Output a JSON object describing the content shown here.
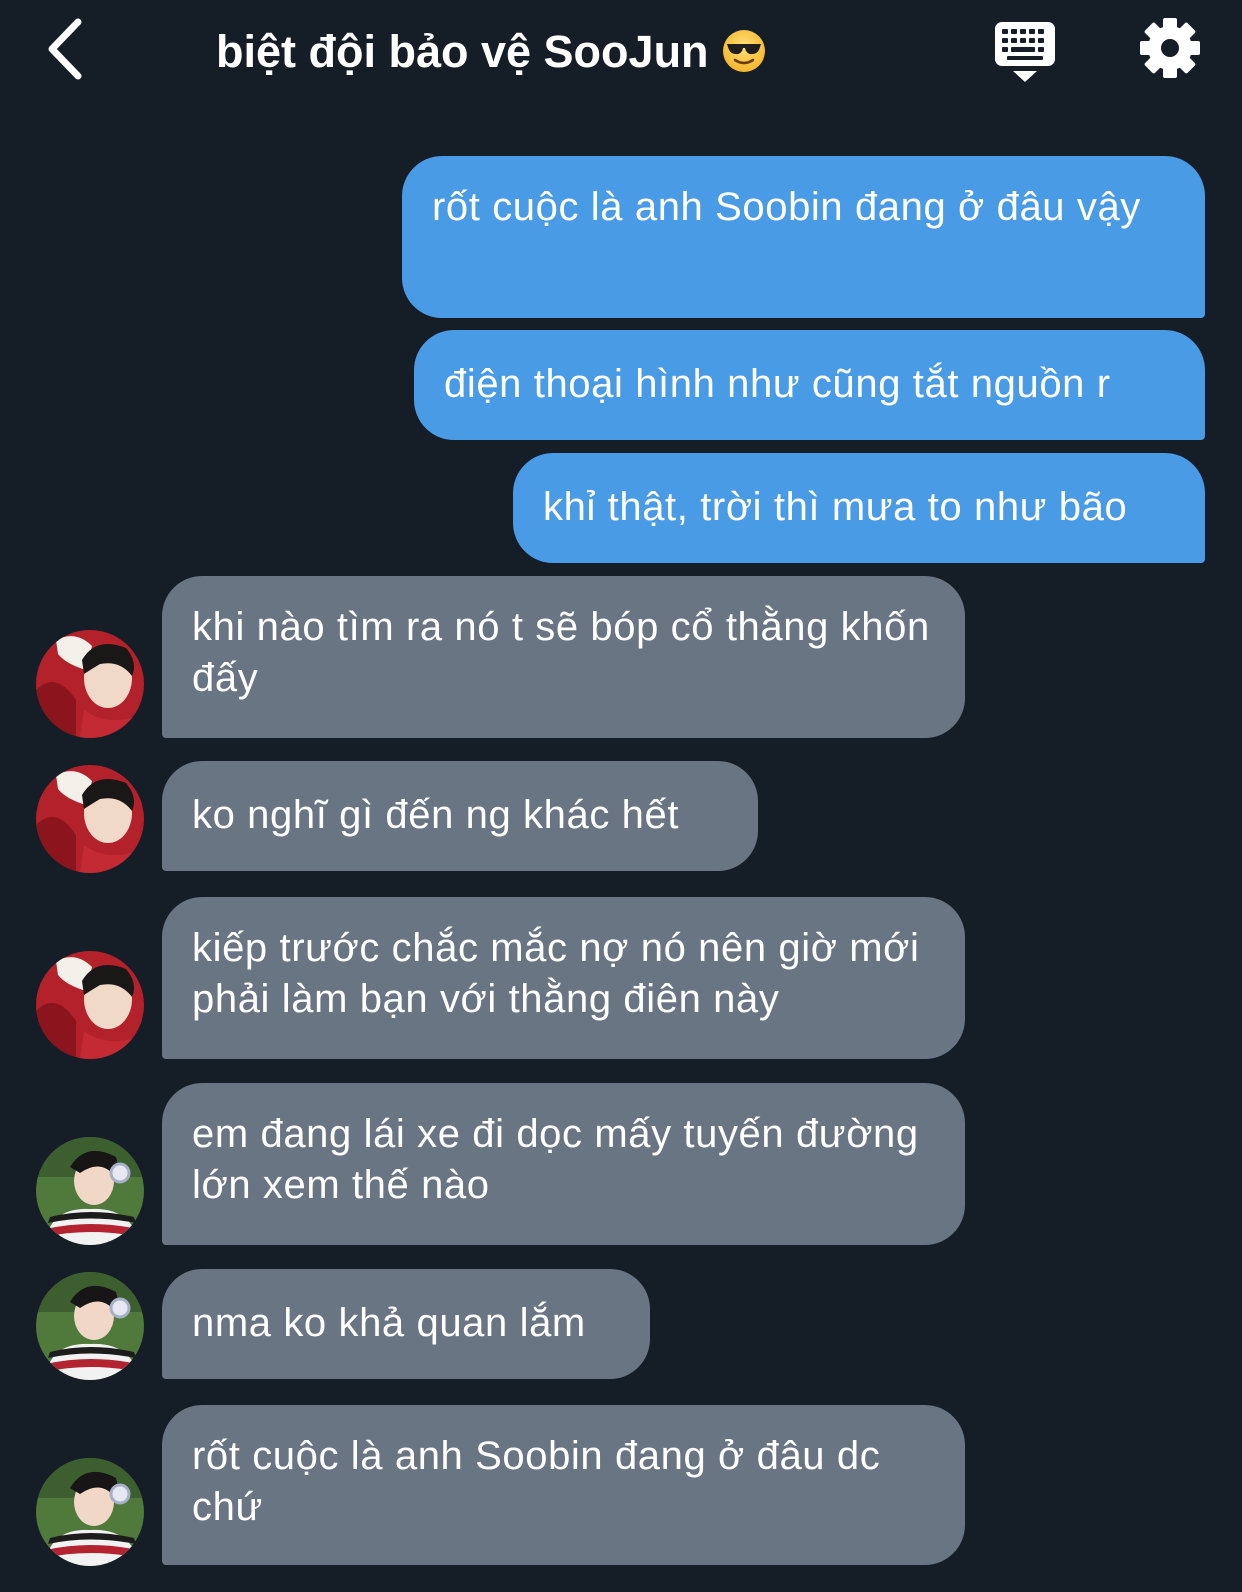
{
  "header": {
    "title": "biệt đội bảo vệ SooJun",
    "title_emoji": "smiling-face-with-sunglasses",
    "back_icon": "chevron-left-icon",
    "keyboard_icon": "keyboard-icon",
    "settings_icon": "gear-icon"
  },
  "colors": {
    "background": "#151d27",
    "outgoing_bubble": "#4a9be6",
    "incoming_bubble": "#6a7584",
    "text": "#ffffff"
  },
  "messages": [
    {
      "direction": "outgoing",
      "text": "rốt cuộc là anh Soobin đang ở đâu vậy"
    },
    {
      "direction": "outgoing",
      "text": "điện thoại hình như cũng tắt nguồn r"
    },
    {
      "direction": "outgoing",
      "text": "khỉ thật, trời thì mưa to như bão"
    },
    {
      "direction": "incoming",
      "sender_avatar": "avatar-red-sweater",
      "text": "khi nào tìm ra nó t sẽ bóp cổ thằng khốn đấy"
    },
    {
      "direction": "incoming",
      "sender_avatar": "avatar-red-sweater",
      "text": "ko nghĩ gì đến ng khác hết"
    },
    {
      "direction": "incoming",
      "sender_avatar": "avatar-red-sweater",
      "text": "kiếp trước chắc mắc nợ nó nên giờ mới phải làm bạn với thằng điên này"
    },
    {
      "direction": "incoming",
      "sender_avatar": "avatar-striped-sweater",
      "text": "em đang lái xe đi dọc mấy tuyến đường lớn xem thế nào"
    },
    {
      "direction": "incoming",
      "sender_avatar": "avatar-striped-sweater",
      "text": "nma ko khả quan lắm"
    },
    {
      "direction": "incoming",
      "sender_avatar": "avatar-striped-sweater",
      "text": "rốt cuộc là anh Soobin đang ở đâu dc chứ"
    }
  ]
}
